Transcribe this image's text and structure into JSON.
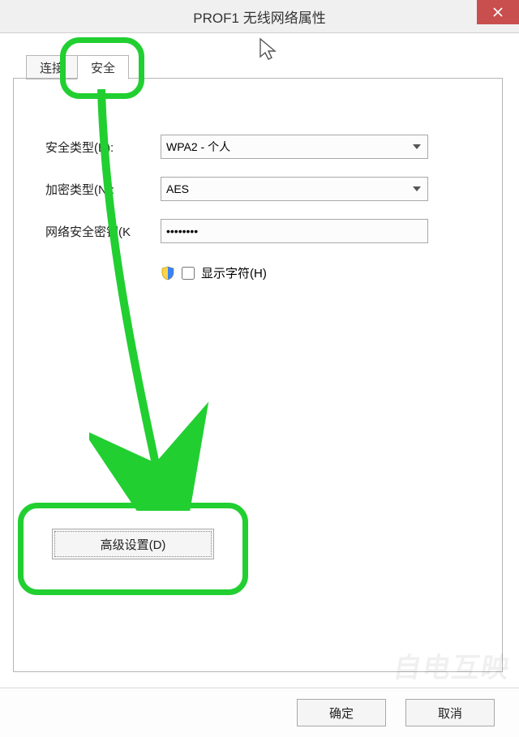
{
  "window": {
    "title": "PROF1 无线网络属性"
  },
  "tabs": {
    "connect": "连接",
    "security": "安全"
  },
  "labels": {
    "security_type": "安全类型(E):",
    "encryption_type": "加密类型(N):",
    "network_key": "网络安全密钥(K",
    "show_chars": "显示字符(H)"
  },
  "values": {
    "security_type": "WPA2 - 个人",
    "encryption_type": "AES",
    "network_key": "••••••••"
  },
  "buttons": {
    "advanced": "高级设置(D)",
    "ok": "确定",
    "cancel": "取消"
  },
  "watermark": "自电互映"
}
